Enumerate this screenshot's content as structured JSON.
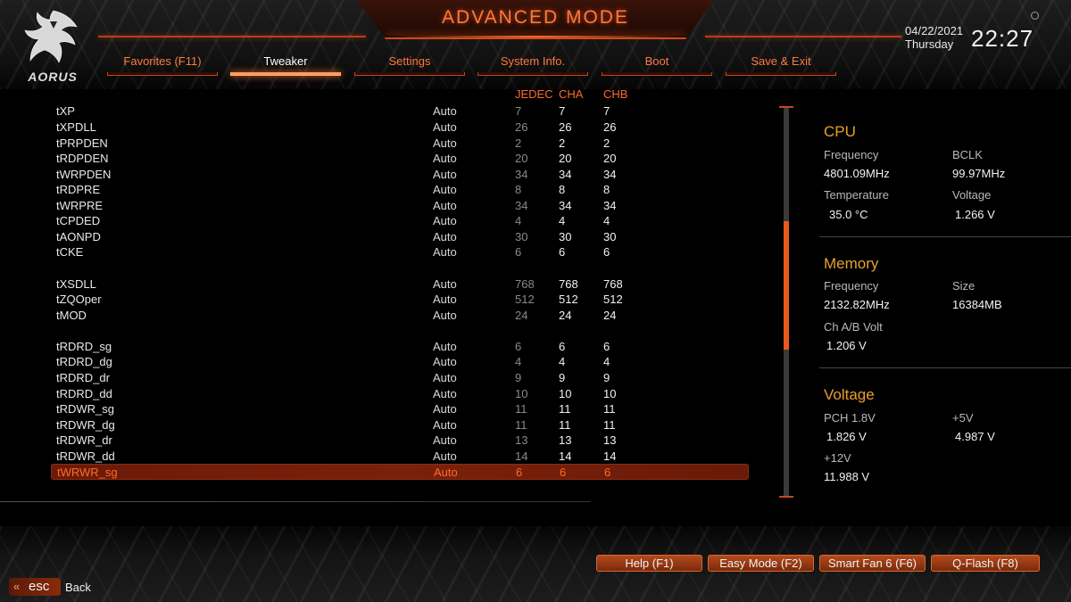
{
  "header": {
    "title": "ADVANCED MODE",
    "brand": "AORUS",
    "date": "04/22/2021",
    "weekday": "Thursday",
    "time": "22:27",
    "accent": "#ff6a2a"
  },
  "tabs": [
    {
      "label": "Favorites (F11)"
    },
    {
      "label": "Tweaker",
      "active": true
    },
    {
      "label": "Settings"
    },
    {
      "label": "System Info."
    },
    {
      "label": "Boot"
    },
    {
      "label": "Save & Exit"
    }
  ],
  "table": {
    "columns": {
      "jedec": "JEDEC",
      "cha": "CHA",
      "chb": "CHB"
    },
    "rows": [
      {
        "name": "tXP",
        "value": "Auto",
        "jedec": "7",
        "cha": "7",
        "chb": "7"
      },
      {
        "name": "tXPDLL",
        "value": "Auto",
        "jedec": "26",
        "cha": "26",
        "chb": "26"
      },
      {
        "name": "tPRPDEN",
        "value": "Auto",
        "jedec": "2",
        "cha": "2",
        "chb": "2"
      },
      {
        "name": "tRDPDEN",
        "value": "Auto",
        "jedec": "20",
        "cha": "20",
        "chb": "20"
      },
      {
        "name": "tWRPDEN",
        "value": "Auto",
        "jedec": "34",
        "cha": "34",
        "chb": "34"
      },
      {
        "name": "tRDPRE",
        "value": "Auto",
        "jedec": "8",
        "cha": "8",
        "chb": "8"
      },
      {
        "name": "tWRPRE",
        "value": "Auto",
        "jedec": "34",
        "cha": "34",
        "chb": "34"
      },
      {
        "name": "tCPDED",
        "value": "Auto",
        "jedec": "4",
        "cha": "4",
        "chb": "4"
      },
      {
        "name": "tAONPD",
        "value": "Auto",
        "jedec": "30",
        "cha": "30",
        "chb": "30"
      },
      {
        "name": "tCKE",
        "value": "Auto",
        "jedec": "6",
        "cha": "6",
        "chb": "6"
      },
      {
        "name": "tXSDLL",
        "value": "Auto",
        "jedec": "768",
        "cha": "768",
        "chb": "768"
      },
      {
        "name": "tZQOper",
        "value": "Auto",
        "jedec": "512",
        "cha": "512",
        "chb": "512"
      },
      {
        "name": "tMOD",
        "value": "Auto",
        "jedec": "24",
        "cha": "24",
        "chb": "24"
      },
      {
        "name": "tRDRD_sg",
        "value": "Auto",
        "jedec": "6",
        "cha": "6",
        "chb": "6"
      },
      {
        "name": "tRDRD_dg",
        "value": "Auto",
        "jedec": "4",
        "cha": "4",
        "chb": "4"
      },
      {
        "name": "tRDRD_dr",
        "value": "Auto",
        "jedec": "9",
        "cha": "9",
        "chb": "9"
      },
      {
        "name": "tRDRD_dd",
        "value": "Auto",
        "jedec": "10",
        "cha": "10",
        "chb": "10"
      },
      {
        "name": "tRDWR_sg",
        "value": "Auto",
        "jedec": "11",
        "cha": "11",
        "chb": "11"
      },
      {
        "name": "tRDWR_dg",
        "value": "Auto",
        "jedec": "11",
        "cha": "11",
        "chb": "11"
      },
      {
        "name": "tRDWR_dr",
        "value": "Auto",
        "jedec": "13",
        "cha": "13",
        "chb": "13"
      },
      {
        "name": "tRDWR_dd",
        "value": "Auto",
        "jedec": "14",
        "cha": "14",
        "chb": "14"
      },
      {
        "name": "tWRWR_sg",
        "value": "Auto",
        "jedec": "6",
        "cha": "6",
        "chb": "6",
        "selected": true
      }
    ]
  },
  "side_panel": {
    "cpu": {
      "heading": "CPU",
      "frequency_label": "Frequency",
      "frequency": "4801.09MHz",
      "bclk_label": "BCLK",
      "bclk": "99.97MHz",
      "temperature_label": "Temperature",
      "temperature": "35.0 °C",
      "voltage_label": "Voltage",
      "voltage": "1.266 V"
    },
    "memory": {
      "heading": "Memory",
      "frequency_label": "Frequency",
      "frequency": "2132.82MHz",
      "size_label": "Size",
      "size": "16384MB",
      "volt_label": "Ch A/B Volt",
      "volt": "1.206 V"
    },
    "voltage": {
      "heading": "Voltage",
      "pch_label": "PCH 1.8V",
      "pch": "1.826 V",
      "v5_label": "+5V",
      "v5": "4.987 V",
      "v12_label": "+12V",
      "v12": "11.988 V"
    },
    "heading_color": "#e8a02c"
  },
  "footer": {
    "help": "Help (F1)",
    "easy_mode": "Easy Mode (F2)",
    "smart_fan": "Smart Fan 6 (F6)",
    "qflash": "Q-Flash (F8)",
    "esc_key": "esc",
    "esc_label": "Back"
  }
}
